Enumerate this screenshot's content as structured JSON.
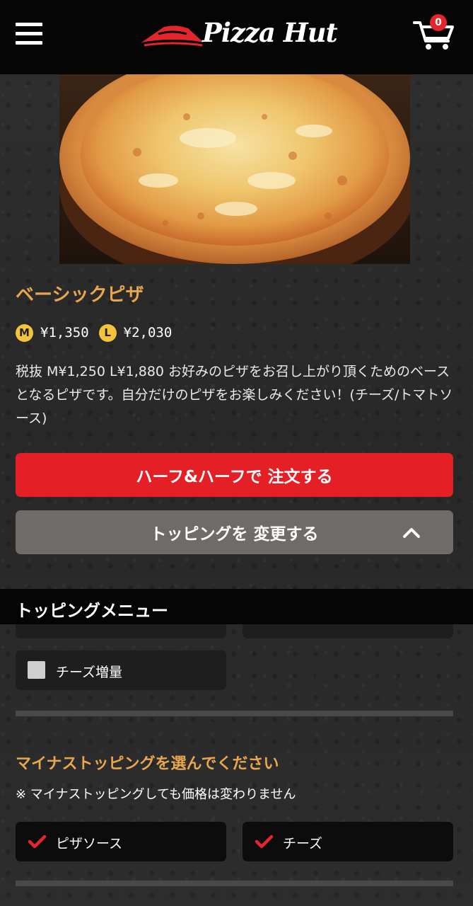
{
  "header": {
    "brand": "Pizza Hut",
    "cart_count": "0"
  },
  "product": {
    "title": "ベーシックピザ",
    "sizes": [
      {
        "badge": "M",
        "price": "¥1,350"
      },
      {
        "badge": "L",
        "price": "¥2,030"
      }
    ],
    "description": "税抜 M¥1,250 L¥1,880 お好みのピザをお召し上がり頂くためのベースとなるピザです。自分だけのピザをお楽しみください！(チーズ/トマトソース)"
  },
  "actions": {
    "half_and_half": "ハーフ&ハーフで 注文する",
    "change_topping": "トッピングを 変更する"
  },
  "topping_menu": {
    "title": "トッピングメニュー",
    "extra_options": [
      {
        "label": "チーズ増量",
        "checked": false
      }
    ]
  },
  "minus_topping": {
    "title": "マイナストッピングを選んでください",
    "note": "※ マイナストッピングしても価格は変わりません",
    "options": [
      {
        "label": "ピザソース",
        "checked": true
      },
      {
        "label": "チーズ",
        "checked": true
      }
    ]
  },
  "colors": {
    "accent_orange": "#e8a64e",
    "primary_red": "#e41f26",
    "secondary_gray": "#6f6b69",
    "size_badge_yellow": "#f3c33c",
    "check_red": "#e3262b"
  }
}
